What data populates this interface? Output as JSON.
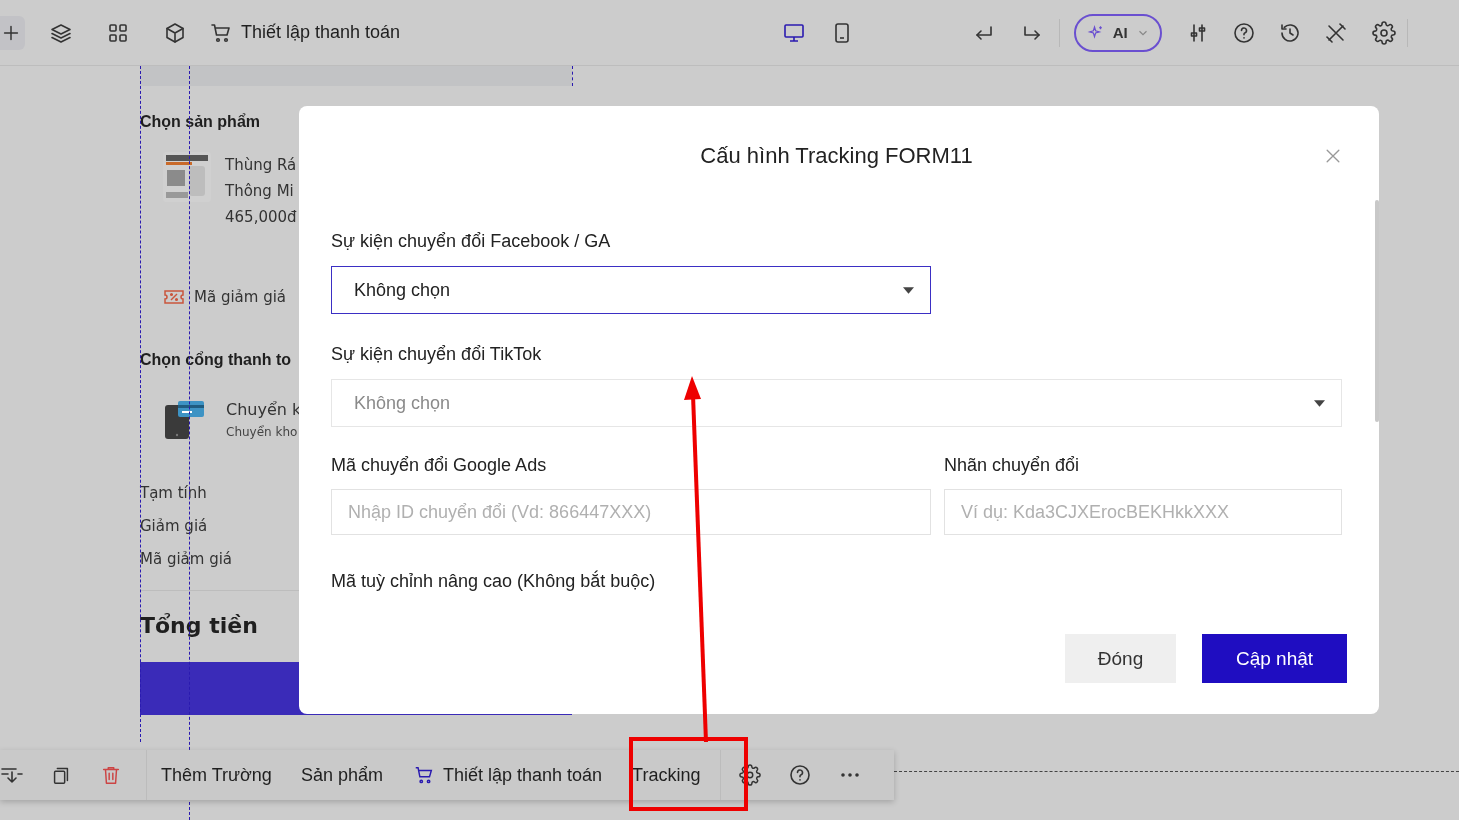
{
  "topbar": {
    "title": "Thiết lập thanh toán",
    "devices": [
      {
        "kind": "desktop",
        "selected": true
      },
      {
        "kind": "tablet",
        "selected": false
      }
    ],
    "ai_button": "AI"
  },
  "page": {
    "product_section": "Chọn sản phẩm",
    "product_lines": [
      "Thùng Rá",
      "Thông Mi",
      "465,000đ"
    ],
    "coupon": "Mã giảm giá",
    "payment_section": "Chọn cổng thanh to",
    "payment_title": "Chuyển k",
    "payment_note": "Chuyển kho",
    "summary_rows": [
      "Tạm tính",
      "Giảm giá",
      "Mã giảm giá"
    ],
    "total": "Tổng tiền"
  },
  "dialog": {
    "title": "Cấu hình Tracking FORM11",
    "selects": [
      {
        "label": "Sự kiện chuyển đổi Facebook / GA",
        "value": "Không chọn",
        "focused": true,
        "disabled": false
      },
      {
        "label": "Sự kiện chuyển đổi TikTok",
        "value": "Không chọn",
        "focused": false,
        "disabled": true
      }
    ],
    "inputs": [
      {
        "label": "Mã chuyển đổi Google Ads",
        "placeholder": "Nhập ID chuyển đổi (Vd: 866447XXX)"
      },
      {
        "label": "Nhãn chuyển đổi",
        "placeholder": "Ví dụ: Kda3CJXErocBEKHkkXXX"
      }
    ],
    "advanced_label": "Mã tuỳ chỉnh nâng cao (Không bắt buộc)",
    "buttons": [
      {
        "label": "Đóng",
        "kind": "secondary"
      },
      {
        "label": "Cập nhật",
        "kind": "primary"
      }
    ]
  },
  "toolbar": {
    "items": [
      {
        "label": "Thêm Trường",
        "kind": "plain"
      },
      {
        "label": "Sản phẩm",
        "kind": "plain"
      },
      {
        "label": "Thiết lập thanh toán",
        "kind": "cart"
      },
      {
        "label": "Tracking",
        "kind": "plain"
      }
    ]
  }
}
